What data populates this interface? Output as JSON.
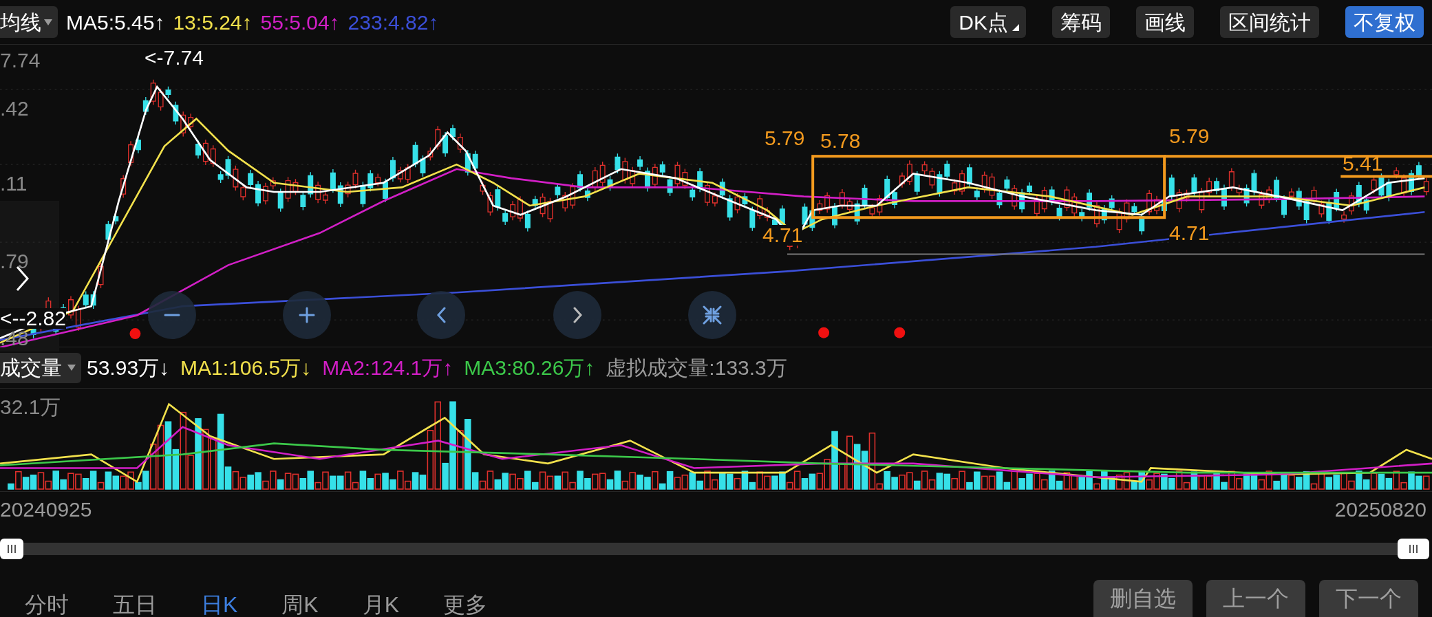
{
  "toolbar": {
    "indicator_select": "均线",
    "ma_readouts": [
      {
        "text": "MA5:5.45↑",
        "color": "#ffffff"
      },
      {
        "text": "13:5.24↑",
        "color": "#f2e14c"
      },
      {
        "text": "55:5.04↑",
        "color": "#d21fc6"
      },
      {
        "text": "233:4.82↑",
        "color": "#3b4fd8"
      }
    ],
    "buttons": [
      {
        "label": "DK点",
        "kind": "dropdown",
        "selected": false
      },
      {
        "label": "筹码",
        "kind": "plain",
        "selected": false
      },
      {
        "label": "画线",
        "kind": "plain",
        "selected": false
      },
      {
        "label": "区间统计",
        "kind": "plain",
        "selected": false
      },
      {
        "label": "不复权",
        "kind": "plain",
        "selected": true
      }
    ]
  },
  "price_chart": {
    "axis_labels": [
      "7.74",
      ".42",
      ".11",
      ".79",
      ".48"
    ],
    "annotations": [
      {
        "text": "<-7.74",
        "color": "#ffffff"
      },
      {
        "text": "<--2.82",
        "color": "#ffffff"
      },
      {
        "text": "5.79",
        "color": "#f39a1e"
      },
      {
        "text": "5.78",
        "color": "#f39a1e"
      },
      {
        "text": "4.71",
        "color": "#f39a1e"
      },
      {
        "text": "5.79",
        "color": "#f39a1e"
      },
      {
        "text": "4.71",
        "color": "#f39a1e"
      },
      {
        "text": "5.41",
        "color": "#f39a1e"
      }
    ]
  },
  "volume": {
    "indicator_select": "成交量",
    "readouts": [
      {
        "text": "53.93万↓",
        "color": "#ffffff"
      },
      {
        "text": "MA1:106.5万↓",
        "color": "#f2e14c"
      },
      {
        "text": "MA2:124.1万↑",
        "color": "#d21fc6"
      },
      {
        "text": "MA3:80.26万↑",
        "color": "#3cc84a"
      },
      {
        "text": "虚拟成交量:133.3万",
        "color": "#9a9a9a"
      }
    ],
    "axis_label": "32.1万"
  },
  "dates": {
    "start": "20240925",
    "end": "20250820"
  },
  "period_tabs": [
    {
      "label": "分时",
      "selected": false
    },
    {
      "label": "五日",
      "selected": false
    },
    {
      "label": "日K",
      "selected": true
    },
    {
      "label": "周K",
      "selected": false
    },
    {
      "label": "月K",
      "selected": false
    },
    {
      "label": "更多",
      "selected": false
    }
  ],
  "action_buttons": [
    "删自选",
    "上一个",
    "下一个"
  ]
}
